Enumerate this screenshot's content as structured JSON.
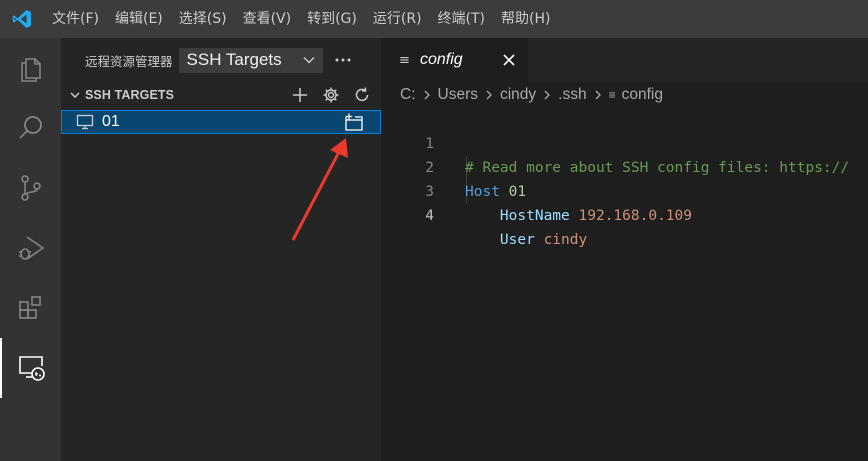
{
  "menu": [
    "文件(F)",
    "编辑(E)",
    "选择(S)",
    "查看(V)",
    "转到(G)",
    "运行(R)",
    "终端(T)",
    "帮助(H)"
  ],
  "activity": [
    "explorer-icon",
    "search-icon",
    "source-control-icon",
    "run-debug-icon",
    "extensions-icon",
    "remote-explorer-icon"
  ],
  "sidebar": {
    "title": "远程资源管理器",
    "select_value": "SSH Targets",
    "section_title": "SSH TARGETS",
    "target_label": "01"
  },
  "editor": {
    "tab_label": "config",
    "breadcrumb": [
      "C:",
      "Users",
      "cindy",
      ".ssh",
      "config"
    ],
    "lines": [
      {
        "num": "1",
        "comment": "# Read more about SSH config files: https://"
      },
      {
        "num": "2",
        "keyword": "Host",
        "value": "01"
      },
      {
        "num": "3",
        "key": "HostName",
        "value": "192.168.0.109"
      },
      {
        "num": "4",
        "key": "User",
        "value": "cindy"
      }
    ]
  },
  "colors": {
    "accent": "#007acc",
    "selection": "#094771",
    "annotation_arrow": "#e83a2f"
  }
}
